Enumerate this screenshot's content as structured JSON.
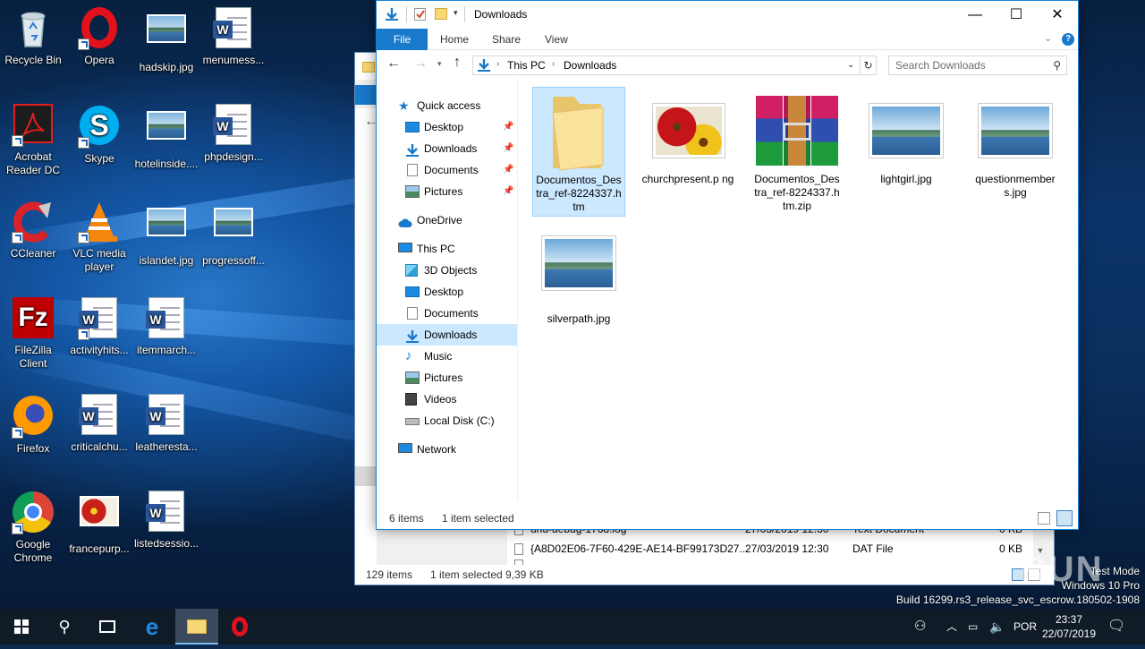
{
  "desktop": {
    "icons": [
      {
        "label": "Recycle Bin",
        "icon": "recycle-bin-icon"
      },
      {
        "label": "Opera",
        "icon": "opera-icon"
      },
      {
        "label": "hadskip.jpg",
        "icon": "image-file-icon"
      },
      {
        "label": "menumess...",
        "icon": "word-document-icon"
      },
      {
        "label": "Acrobat Reader DC",
        "icon": "acrobat-icon"
      },
      {
        "label": "Skype",
        "icon": "skype-icon"
      },
      {
        "label": "hotelinside....",
        "icon": "image-file-icon"
      },
      {
        "label": "phpdesign...",
        "icon": "word-document-icon"
      },
      {
        "label": "CCleaner",
        "icon": "ccleaner-icon"
      },
      {
        "label": "VLC media player",
        "icon": "vlc-icon"
      },
      {
        "label": "islandet.jpg",
        "icon": "image-file-icon"
      },
      {
        "label": "progressoff...",
        "icon": "image-file-icon"
      },
      {
        "label": "FileZilla Client",
        "icon": "filezilla-icon"
      },
      {
        "label": "activityhits...",
        "icon": "word-document-icon"
      },
      {
        "label": "itemmarch...",
        "icon": "word-document-icon"
      },
      {
        "label": "Firefox",
        "icon": "firefox-icon"
      },
      {
        "label": "criticalchu...",
        "icon": "word-document-icon"
      },
      {
        "label": "leatheresta...",
        "icon": "word-document-icon"
      },
      {
        "label": "Google Chrome",
        "icon": "chrome-icon"
      },
      {
        "label": "francepurp...",
        "icon": "image-file-icon"
      },
      {
        "label": "listedsessio...",
        "icon": "word-document-icon"
      }
    ]
  },
  "back_window": {
    "rows": [
      {
        "name": "unu-debug-1768.log",
        "date": "27/03/2019 12:30",
        "type": "Text Document",
        "size": "0 KB"
      },
      {
        "name": "{A8D02E06-7F60-429E-AE14-BF99173D27...",
        "date": "27/03/2019 12:30",
        "type": "DAT File",
        "size": "0 KB"
      }
    ],
    "status_items": "129 items",
    "status_selected": "1 item selected",
    "status_size": "9,39 KB"
  },
  "explorer": {
    "title": "Downloads",
    "ribbon_tabs": [
      "File",
      "Home",
      "Share",
      "View"
    ],
    "breadcrumb": [
      "This PC",
      "Downloads"
    ],
    "search_placeholder": "Search Downloads",
    "nav": {
      "quick_access": "Quick access",
      "quick_items": [
        "Desktop",
        "Downloads",
        "Documents",
        "Pictures"
      ],
      "onedrive": "OneDrive",
      "this_pc": "This PC",
      "pc_items": [
        "3D Objects",
        "Desktop",
        "Documents",
        "Downloads",
        "Music",
        "Pictures",
        "Videos",
        "Local Disk (C:)"
      ],
      "network": "Network"
    },
    "files": [
      {
        "name": "Documentos_Destra_ref-8224337.htm",
        "display": "Documentos_Des tra_ref-8224337.h tm",
        "kind": "folder",
        "selected": true
      },
      {
        "name": "churchpresent.png",
        "display": "churchpresent.p ng",
        "kind": "flower",
        "selected": false
      },
      {
        "name": "Documentos_Destra_ref-8224337.htm.zip",
        "display": "Documentos_Des tra_ref-8224337.h tm.zip",
        "kind": "rar",
        "selected": false
      },
      {
        "name": "lightgirl.jpg",
        "display": "lightgirl.jpg",
        "kind": "landscape",
        "selected": false
      },
      {
        "name": "questionmembers.jpg",
        "display": "questionmember s.jpg",
        "kind": "landscape",
        "selected": false
      },
      {
        "name": "silverpath.jpg",
        "display": "silverpath.jpg",
        "kind": "landscape",
        "selected": false
      }
    ],
    "status_items": "6 items",
    "status_selected": "1 item selected"
  },
  "taskbar": {
    "tray": {
      "lang": "POR",
      "time": "23:37",
      "date": "22/07/2019"
    }
  },
  "watermark": {
    "line1": "Test Mode",
    "line2": "Windows 10 Pro",
    "line3": "Build 16299.rs3_release_svc_escrow.180502-1908",
    "brand": "ANY RUN"
  }
}
